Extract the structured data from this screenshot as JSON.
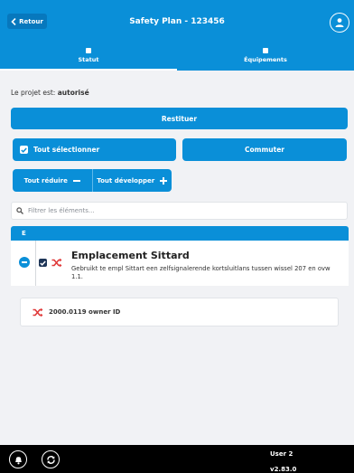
{
  "header": {
    "back_label": "Retour",
    "title": "Safety Plan - 123456"
  },
  "tabs": [
    {
      "label": "Statut",
      "active": true
    },
    {
      "label": "Équipements",
      "active": false
    }
  ],
  "status": {
    "prefix": "Le projet est: ",
    "value": "autorisé"
  },
  "actions": {
    "restituer_label": "Restituer",
    "select_all_label": "Tout sélectionner",
    "select_all_checked": true,
    "commuter_label": "Commuter",
    "collapse_all_label": "Tout réduire",
    "expand_all_label": "Tout développer"
  },
  "filter": {
    "placeholder": "Filtrer les éléments...",
    "value": ""
  },
  "section": {
    "label": "E"
  },
  "item": {
    "title": "Emplacement Sittard",
    "description": "Gebruikt te empl Sittart een zelfsignalerende kortsluitlans tussen wissel 207 en ovw 1.1.",
    "checked": true
  },
  "owner": {
    "label": "2000.0119 owner ID"
  },
  "footer": {
    "user": "User 2",
    "version": "v2.83.0"
  },
  "colors": {
    "primary": "#0a8fd8",
    "accent_red": "#e03a3a",
    "dark_check": "#1d3557",
    "footer_bg": "#000000"
  }
}
